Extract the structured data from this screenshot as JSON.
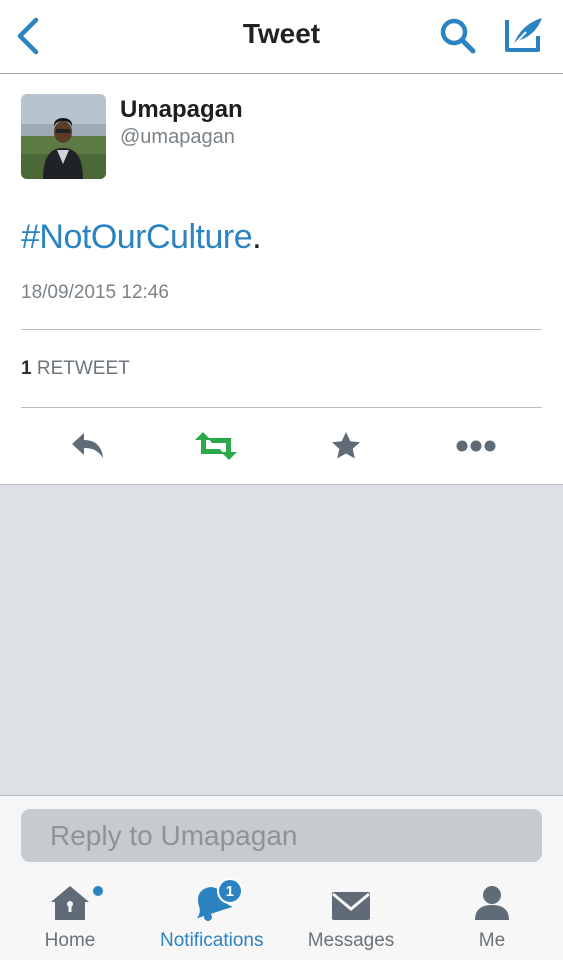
{
  "nav": {
    "title": "Tweet",
    "back_icon": "chevron-left-icon",
    "search_icon": "search-icon",
    "compose_icon": "compose-icon"
  },
  "tweet": {
    "author_name": "Umapagan",
    "author_handle": "@umapagan",
    "hashtag": "#NotOurCulture",
    "text_suffix": ".",
    "timestamp": "18/09/2015 12:46",
    "retweet_count": "1",
    "retweet_label": "RETWEET"
  },
  "actions": [
    {
      "name": "reply",
      "icon": "reply-icon"
    },
    {
      "name": "retweet",
      "icon": "retweet-icon",
      "color": "#2ba84a"
    },
    {
      "name": "favorite",
      "icon": "star-icon"
    },
    {
      "name": "more",
      "icon": "more-icon"
    }
  ],
  "reply": {
    "placeholder": "Reply to Umapagan"
  },
  "tabs": [
    {
      "label": "Home",
      "icon": "home-icon",
      "has_dot": true
    },
    {
      "label": "Notifications",
      "icon": "bell-icon",
      "badge": "1",
      "active": true
    },
    {
      "label": "Messages",
      "icon": "envelope-icon"
    },
    {
      "label": "Me",
      "icon": "person-icon"
    }
  ],
  "colors": {
    "accent": "#2b84c1",
    "retweet_green": "#2ba84a",
    "icon_gray": "#5f6b77",
    "empty_area": "#dde0e4"
  }
}
